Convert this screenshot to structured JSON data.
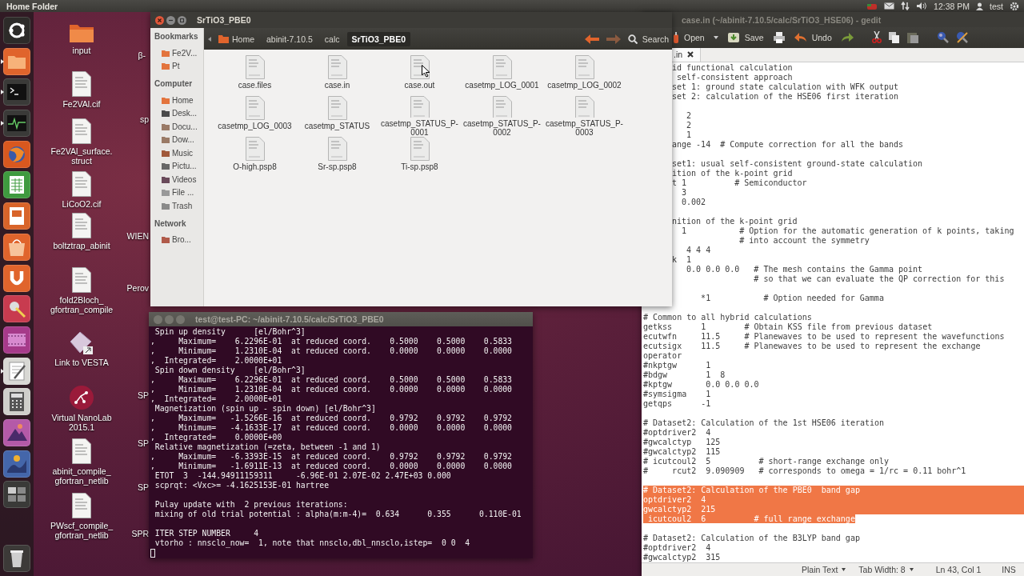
{
  "top_bar": {
    "title": "Home Folder",
    "clock": "12:38 PM",
    "user": "test"
  },
  "launcher": [
    {
      "kind": "ubuntu",
      "running": false
    },
    {
      "kind": "files",
      "running": true
    },
    {
      "kind": "terminal",
      "running": true
    },
    {
      "kind": "monitor",
      "running": true
    },
    {
      "kind": "browser",
      "running": false
    },
    {
      "kind": "spreadsheet",
      "running": false
    },
    {
      "kind": "presentation",
      "running": false
    },
    {
      "kind": "store",
      "running": false
    },
    {
      "kind": "horseshoe",
      "running": false
    },
    {
      "kind": "tools",
      "running": false
    },
    {
      "kind": "video",
      "running": false
    },
    {
      "kind": "editor",
      "running": true
    },
    {
      "kind": "calculator",
      "running": false
    },
    {
      "kind": "mountain",
      "running": false
    },
    {
      "kind": "wave",
      "running": false
    },
    {
      "kind": "workspaces",
      "running": false
    }
  ],
  "trash": {
    "kind": "trash"
  },
  "desktop_icons": [
    {
      "label": "input",
      "kind": "folder"
    },
    {
      "label": "Fe2VAl.cif",
      "kind": "document"
    },
    {
      "label": "Fe2VAl_surface.\nstruct",
      "kind": "document"
    },
    {
      "label": "LiCoO2.cif",
      "kind": "document"
    },
    {
      "label": "boltztrap_abinit",
      "kind": "document"
    },
    {
      "label": "fold2Bloch_\ngfortran_compile",
      "kind": "document"
    },
    {
      "label": "Link to VESTA",
      "kind": "link"
    },
    {
      "label": "Virtual NanoLab\n2015.1",
      "kind": "app"
    },
    {
      "label": "abinit_compile_\ngfortran_netlib",
      "kind": "document"
    },
    {
      "label": "PWscf_compile_\ngfortran_netlib",
      "kind": "document"
    }
  ],
  "desktop_partial_labels": [
    "β-",
    "sp",
    "WIEN",
    "Perov",
    "SP",
    "SP",
    "SP",
    "SPR"
  ],
  "file_manager": {
    "title": "SrTiO3_PBE0",
    "sidebar": [
      {
        "heading": "Bookmarks",
        "items": [
          {
            "label": "Fe2V...",
            "kind": "folder"
          },
          {
            "label": "Pt",
            "kind": "folder"
          }
        ]
      },
      {
        "heading": "Computer",
        "items": [
          {
            "label": "Home",
            "kind": "home"
          },
          {
            "label": "Desk...",
            "kind": "desktop"
          },
          {
            "label": "Docu...",
            "kind": "documents"
          },
          {
            "label": "Dow...",
            "kind": "downloads"
          },
          {
            "label": "Music",
            "kind": "music"
          },
          {
            "label": "Pictu...",
            "kind": "pictures"
          },
          {
            "label": "Videos",
            "kind": "videos"
          },
          {
            "label": "File ...",
            "kind": "filesystem"
          },
          {
            "label": "Trash",
            "kind": "trash"
          }
        ]
      },
      {
        "heading": "Network",
        "items": [
          {
            "label": "Bro...",
            "kind": "network"
          }
        ]
      }
    ],
    "breadcrumb": [
      {
        "label": "Home",
        "selected": false
      },
      {
        "label": "abinit-7.10.5",
        "selected": false
      },
      {
        "label": "calc",
        "selected": false
      },
      {
        "label": "SrTiO3_PBE0",
        "selected": true
      }
    ],
    "search": "Search",
    "files": [
      {
        "name": "case.files"
      },
      {
        "name": "case.in"
      },
      {
        "name": "case.out"
      },
      {
        "name": "casetmp_LOG_0001"
      },
      {
        "name": "casetmp_LOG_0002"
      },
      {
        "name": "casetmp_LOG_0003"
      },
      {
        "name": "casetmp_STATUS"
      },
      {
        "name": "casetmp_STATUS_P-\n0001"
      },
      {
        "name": "casetmp_STATUS_P-\n0002"
      },
      {
        "name": "casetmp_STATUS_P-\n0003"
      },
      {
        "name": "O-high.psp8"
      },
      {
        "name": "Sr-sp.psp8"
      },
      {
        "name": "Ti-sp.psp8"
      }
    ]
  },
  "terminal": {
    "title": "test@test-PC: ~/abinit-7.10.5/calc/SrTiO3_PBE0",
    "cursor_visible": true,
    "blocks": [
      [
        " Spin up density      [el/Bohr^3]",
        ",     Maximum=    6.2296E-01  at reduced coord.    0.5000    0.5000    0.5833",
        ",     Minimum=    1.2310E-04  at reduced coord.    0.0000    0.0000    0.0000",
        ",  Integrated=    2.0000E+01",
        " Spin down density    [el/Bohr^3]",
        ",     Maximum=    6.2296E-01  at reduced coord.    0.5000    0.5000    0.5833",
        ",     Minimum=    1.2310E-04  at reduced coord.    0.0000    0.0000    0.0000",
        ",  Integrated=    2.0000E+01",
        " Magnetization (spin up - spin down) [el/Bohr^3]",
        ",     Maximum=   -1.5266E-16  at reduced coord.    0.9792    0.9792    0.9792",
        ",     Minimum=   -4.1633E-17  at reduced coord.    0.0000    0.0000    0.0000",
        ",  Integrated=    0.0000E+00",
        " Relative magnetization (=zeta, between -1 and 1)",
        ",     Maximum=   -6.3393E-15  at reduced coord.    0.9792    0.9792    0.9792",
        ",     Minimum=   -1.6911E-13  at reduced coord.    0.0000    0.0000    0.0000",
        " ETOT  3  -144.94911159311     -6.96E-01 2.07E-02 2.47E+03 0.000",
        " scprqt: <Vxc>= -4.1625153E-01 hartree"
      ],
      [
        " Pulay update with  2 previous iterations:",
        " mixing of old trial potential : alpha(m:m-4)=  0.634      0.355      0.110E-01"
      ],
      [
        " ITER STEP NUMBER     4",
        " vtorho : nnsclo_now=  1, note that nnsclo,dbl_nnsclo,istep=  0 0  4"
      ]
    ]
  },
  "gedit": {
    "title": "case.in (~/abinit-7.10.5/calc/SrTiO3_HSE06) - gedit",
    "toolbar": [
      {
        "kind": "open",
        "label": "Open"
      },
      {
        "kind": "dropdown"
      },
      {
        "kind": "save",
        "label": "Save"
      },
      {
        "kind": "print"
      },
      {
        "kind": "undo",
        "label": "Undo"
      },
      {
        "kind": "redo"
      },
      {
        "kind": "cut"
      },
      {
        "kind": "copy"
      },
      {
        "kind": "paste"
      },
      {
        "kind": "find"
      },
      {
        "kind": "replace"
      }
    ],
    "tab": ".in",
    "partly_covered_blocks": [
      [
        "id functional calculation",
        " self-consistent approach",
        "set 1: ground state calculation with WFK output",
        "set 2: calculation of the HSE06 first iteration"
      ],
      [
        "   2",
        "   2",
        "   1",
        "ange -14  # Compute correction for all the bands"
      ],
      [
        "set1: usual self-consistent ground-state calculation",
        "ition of the k-point grid",
        "t 1          # Semiconductor",
        "  3",
        "  0.002"
      ],
      [
        "nition of the k-point grid",
        "  1           # Option for the automatic generation of k points, taking",
        "              # into account the symmetry",
        "   4 4 4",
        "k  1",
        "   0.0 0.0 0.0   # The mesh contains the Gamma point",
        "                 # so that we can evaluate the QP correction for this"
      ],
      [
        "      *1           # Option needed for Gamma"
      ]
    ],
    "blocks": [
      [
        {
          "text": "# Common to all hybrid calculations",
          "selected": false
        },
        {
          "text": "getkss      1        # Obtain KSS file from previous dataset",
          "selected": false
        },
        {
          "text": "ecutwfn     11.5     # Planewaves to be used to represent the wavefunctions",
          "selected": false
        },
        {
          "text": "ecutsigx    11.5     # Planewaves to be used to represent the exchange",
          "selected": false
        },
        {
          "text": "operator",
          "selected": false
        },
        {
          "text": "#nkptgw      1",
          "selected": false
        },
        {
          "text": "#bdgw        1  8",
          "selected": false
        },
        {
          "text": "#kptgw       0.0 0.0 0.0",
          "selected": false
        },
        {
          "text": "#symsigma    1",
          "selected": false
        },
        {
          "text": "getqps      -1",
          "selected": false
        }
      ],
      [
        {
          "text": "# Dataset2: Calculation of the 1st HSE06 iteration",
          "selected": false
        },
        {
          "text": "#optdriver2  4",
          "selected": false
        },
        {
          "text": "#gwcalctyp   125",
          "selected": false
        },
        {
          "text": "#gwcalctyp2  115",
          "selected": false
        },
        {
          "text": "# icutcoul2  5          # short-range exchange only",
          "selected": false
        },
        {
          "text": "#     rcut2  9.090909   # corresponds to omega = 1/rc = 0.11 bohr^1",
          "selected": false
        }
      ],
      [
        {
          "text": "# Dataset2: Calculation of the PBE0  band gap",
          "selected": true
        },
        {
          "text": "optdriver2  4",
          "selected": true
        },
        {
          "text": "gwcalctyp2  215",
          "selected": true
        },
        {
          "text": " icutcoul2  6          # full range exchange",
          "selected": true
        }
      ],
      [
        {
          "text": "# Dataset2: Calculation of the B3LYP band gap",
          "selected": false
        },
        {
          "text": "#optdriver2  4",
          "selected": false
        },
        {
          "text": "#gwcalctyp2  315",
          "selected": false
        }
      ]
    ],
    "status_bar": {
      "language": "Plain Text",
      "tab_width": "Tab Width: 8",
      "position": "Ln 43, Col 1",
      "mode": "INS"
    }
  }
}
